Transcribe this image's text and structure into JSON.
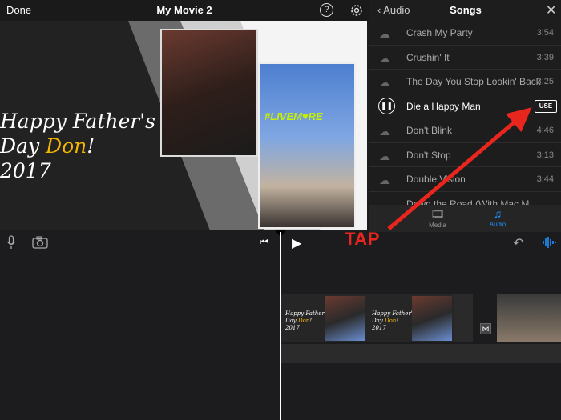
{
  "topbar": {
    "done_label": "Done",
    "title": "My Movie 2",
    "help_label": "?"
  },
  "preview": {
    "title_line1": "Happy Father's",
    "title_line2_prefix": "Day ",
    "title_name": "Don",
    "title_line2_suffix": "!",
    "title_line3": "2017",
    "photo_overlay_text": "#LIVEM♥RE"
  },
  "audio_panel": {
    "back_label": "Audio",
    "title": "Songs",
    "songs": [
      {
        "name": "Crash My Party",
        "duration": "3:54"
      },
      {
        "name": "Crushin' It",
        "duration": "3:39"
      },
      {
        "name": "The Day You Stop Lookin' Back",
        "duration": "3:25"
      },
      {
        "name": "Die a Happy Man",
        "duration": "",
        "use_label": "USE"
      },
      {
        "name": "Don't Blink",
        "duration": "4:46"
      },
      {
        "name": "Don't Stop",
        "duration": "3:13"
      },
      {
        "name": "Double Vision",
        "duration": "3:44"
      },
      {
        "name": "Down the Road (With Mac M...",
        "duration": ""
      }
    ],
    "tabs": [
      {
        "label": "Media",
        "icon": "film-icon"
      },
      {
        "label": "Audio",
        "icon": "music-note-icon"
      }
    ],
    "accent_color": "#1e90ff"
  },
  "annotation": {
    "tap_label": "TAP",
    "color": "#e8261e"
  },
  "timeline": {
    "clip_title_line1": "Happy Father's",
    "clip_title_line2_prefix": "Day ",
    "clip_title_name": "Don",
    "clip_title_line2_suffix": "!",
    "clip_title_line3": "2017"
  }
}
